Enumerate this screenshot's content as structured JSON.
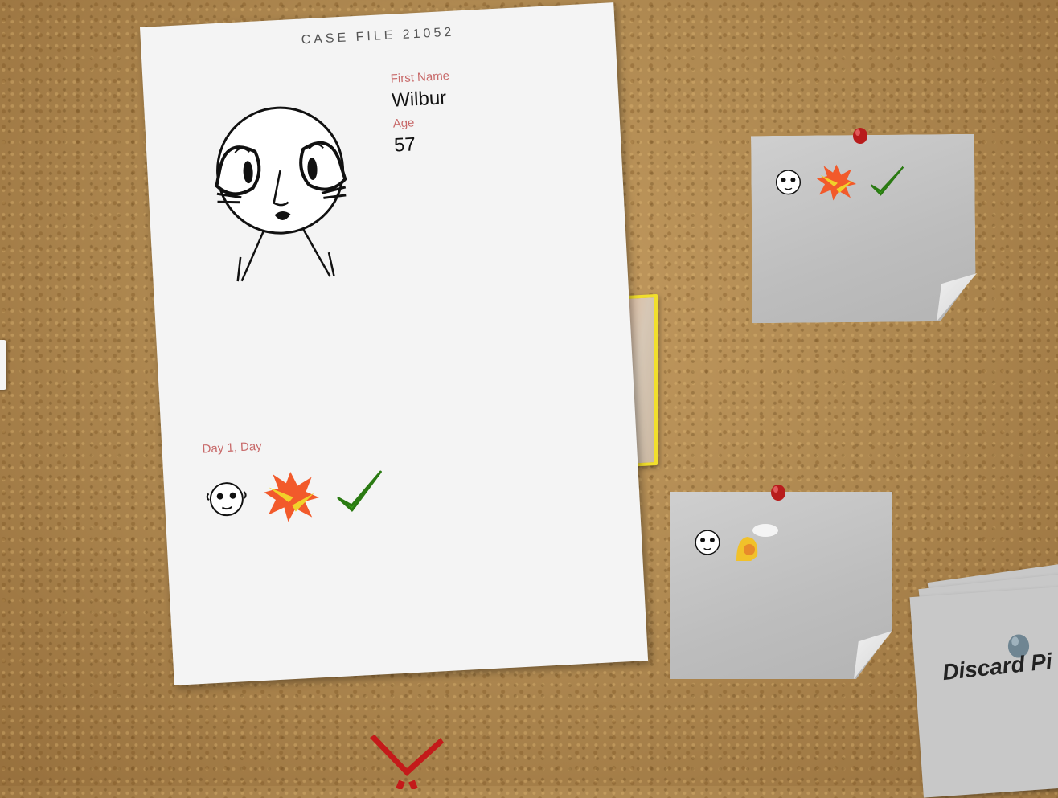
{
  "case_file": {
    "title": "CASE FILE 21052",
    "first_name_label": "First Name",
    "first_name": "Wilbur",
    "age_label": "Age",
    "age": "57",
    "report_day_label": "Day 1, Day",
    "report_icons": [
      "face-icon",
      "fight-icon",
      "checkmark-icon"
    ]
  },
  "notes": [
    {
      "icons": [
        "face-icon",
        "fight-icon",
        "checkmark-icon"
      ],
      "pin_color": "#b81c1c"
    },
    {
      "icons": [
        "face-icon",
        "speech-icon"
      ],
      "pin_color": "#b81c1c"
    }
  ],
  "discard_pile": {
    "label": "Discard Pi",
    "pin_color": "#6f8592"
  },
  "colors": {
    "accent_label": "#c86a6a",
    "board": "#b08a52",
    "approve": "#3aa31b",
    "reject": "#c41a1a"
  }
}
